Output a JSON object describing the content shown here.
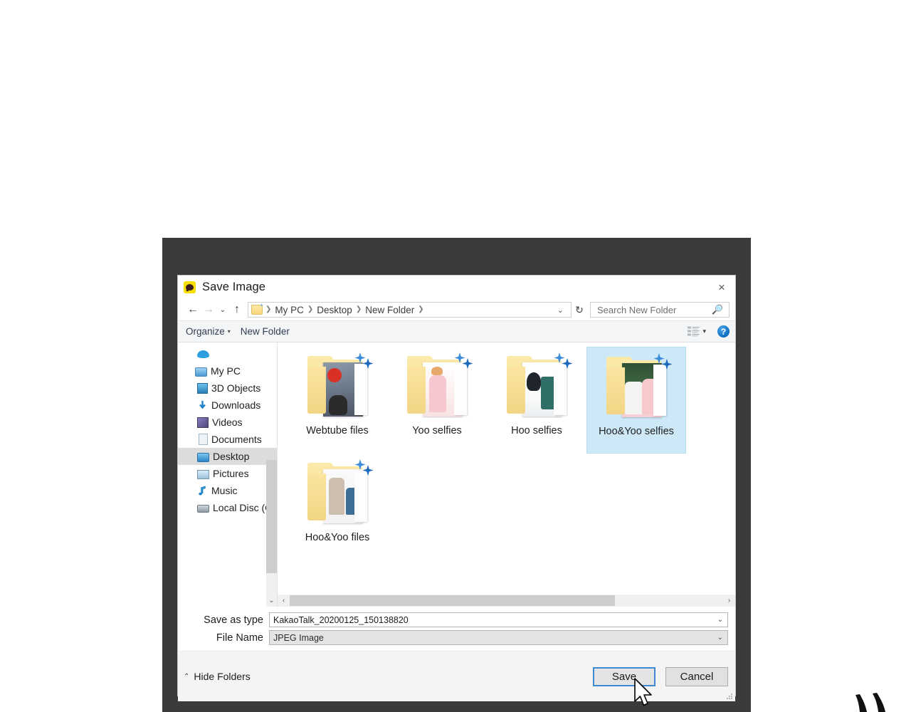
{
  "window": {
    "title": "Save Image",
    "app_icon": "kakaotalk-icon",
    "close_label": "×"
  },
  "addressbar": {
    "back_icon": "←",
    "forward_icon": "→",
    "recent_icon": "⌄",
    "up_icon": "↑",
    "folder_icon": "folder-icon",
    "crumbs": [
      "My PC",
      "Desktop",
      "New Folder"
    ],
    "separator": "❯",
    "dropdown_icon": "⌄",
    "refresh_icon": "↻"
  },
  "search": {
    "placeholder": "Search New Folder",
    "value": "",
    "icon": "search-icon"
  },
  "commandbar": {
    "organize_label": "Organize",
    "organize_caret": "▾",
    "new_folder_label": "New Folder",
    "view_icon": "list-view-icon",
    "view_caret": "▾",
    "help_label": "?"
  },
  "sidebar": {
    "items": [
      {
        "label": "",
        "icon": "onedrive-cloud-icon",
        "indent": 0,
        "selected": false
      },
      {
        "label": "My PC",
        "icon": "computer-icon",
        "indent": 0,
        "selected": false
      },
      {
        "label": "3D Objects",
        "icon": "3d-objects-icon",
        "indent": 1,
        "selected": false
      },
      {
        "label": "Downloads",
        "icon": "downloads-icon",
        "indent": 1,
        "selected": false
      },
      {
        "label": "Videos",
        "icon": "videos-icon",
        "indent": 1,
        "selected": false
      },
      {
        "label": "Documents",
        "icon": "documents-icon",
        "indent": 1,
        "selected": false
      },
      {
        "label": "Desktop",
        "icon": "desktop-icon",
        "indent": 1,
        "selected": true
      },
      {
        "label": "Pictures",
        "icon": "pictures-icon",
        "indent": 1,
        "selected": false
      },
      {
        "label": "Music",
        "icon": "music-icon",
        "indent": 1,
        "selected": false
      },
      {
        "label": "Local Disc (C:)",
        "icon": "local-disk-icon",
        "indent": 1,
        "selected": false
      }
    ],
    "scroll_down_icon": "⌄"
  },
  "files": {
    "items": [
      {
        "name": "Webtube files",
        "type": "folder-shortcut",
        "selected": false,
        "art": "a1"
      },
      {
        "name": "Yoo selfies",
        "type": "folder-shortcut",
        "selected": false,
        "art": "a2"
      },
      {
        "name": "Hoo selfies",
        "type": "folder-shortcut",
        "selected": false,
        "art": "a3"
      },
      {
        "name": "Hoo&Yoo selfies",
        "type": "folder-shortcut",
        "selected": true,
        "art": "a4"
      },
      {
        "name": "Hoo&Yoo files",
        "type": "folder-shortcut",
        "selected": false,
        "art": "a5"
      }
    ],
    "hscroll_left_icon": "‹",
    "hscroll_right_icon": "›"
  },
  "form": {
    "row1": {
      "label": "Save as type",
      "value": "KakaoTalk_20200125_150138820",
      "caret": "⌄"
    },
    "row2": {
      "label": "File Name",
      "value": "JPEG Image",
      "caret": "⌄"
    }
  },
  "footer": {
    "hide_folders_caret": "⌃",
    "hide_folders_label": "Hide Folders",
    "save_label": "Save",
    "cancel_label": "Cancel"
  },
  "colors": {
    "accent": "#3c8ad1",
    "selection": "#cde8f7",
    "frame": "#3b3b3b",
    "kakao_yellow": "#f7e000"
  }
}
